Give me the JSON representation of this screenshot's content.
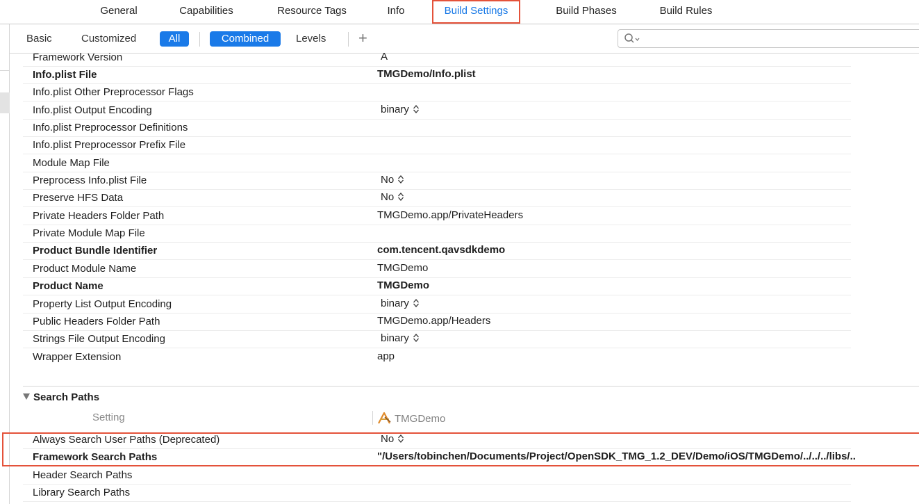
{
  "tabs": [
    {
      "label": "General"
    },
    {
      "label": "Capabilities"
    },
    {
      "label": "Resource Tags"
    },
    {
      "label": "Info"
    },
    {
      "label": "Build Settings",
      "active": true
    },
    {
      "label": "Build Phases"
    },
    {
      "label": "Build Rules"
    }
  ],
  "filters": {
    "basic": "Basic",
    "customized": "Customized",
    "all": "All",
    "combined": "Combined",
    "levels": "Levels",
    "add": "+"
  },
  "search": {
    "value": "",
    "icon": "search-icon"
  },
  "rows": [
    {
      "name": "Framework Version",
      "value": "A",
      "bold": false
    },
    {
      "name": "Info.plist File",
      "value": "TMGDemo/Info.plist",
      "bold": true
    },
    {
      "name": "Info.plist Other Preprocessor Flags",
      "value": "",
      "bold": false
    },
    {
      "name": "Info.plist Output Encoding",
      "value": "binary",
      "bold": false,
      "dropdown": true
    },
    {
      "name": "Info.plist Preprocessor Definitions",
      "value": "",
      "bold": false
    },
    {
      "name": "Info.plist Preprocessor Prefix File",
      "value": "",
      "bold": false
    },
    {
      "name": "Module Map File",
      "value": "",
      "bold": false
    },
    {
      "name": "Preprocess Info.plist File",
      "value": "No",
      "bold": false,
      "dropdown": true
    },
    {
      "name": "Preserve HFS Data",
      "value": "No",
      "bold": false,
      "dropdown": true
    },
    {
      "name": "Private Headers Folder Path",
      "value": "TMGDemo.app/PrivateHeaders",
      "bold": false
    },
    {
      "name": "Private Module Map File",
      "value": "",
      "bold": false
    },
    {
      "name": "Product Bundle Identifier",
      "value": "com.tencent.qavsdkdemo",
      "bold": true
    },
    {
      "name": "Product Module Name",
      "value": "TMGDemo",
      "bold": false
    },
    {
      "name": "Product Name",
      "value": "TMGDemo",
      "bold": true
    },
    {
      "name": "Property List Output Encoding",
      "value": "binary",
      "bold": false,
      "dropdown": true
    },
    {
      "name": "Public Headers Folder Path",
      "value": "TMGDemo.app/Headers",
      "bold": false
    },
    {
      "name": "Strings File Output Encoding",
      "value": "binary",
      "bold": false,
      "dropdown": true
    },
    {
      "name": "Wrapper Extension",
      "value": "app",
      "bold": false
    }
  ],
  "search_paths": {
    "title": "Search Paths",
    "column_setting": "Setting",
    "column_target": "TMGDemo",
    "rows": [
      {
        "name": "Always Search User Paths (Deprecated)",
        "value": "No",
        "bold": false,
        "dropdown": true
      },
      {
        "name": "Framework Search Paths",
        "value": "\"/Users/tobinchen/Documents/Project/OpenSDK_TMG_1.2_DEV/Demo/iOS/TMGDemo/../../../libs/..",
        "bold": true
      },
      {
        "name": "Header Search Paths",
        "value": "",
        "bold": false
      },
      {
        "name": "Library Search Paths",
        "value": "",
        "bold": false
      }
    ]
  },
  "colors": {
    "accent": "#1a7ae8",
    "highlight": "#e4523a"
  }
}
